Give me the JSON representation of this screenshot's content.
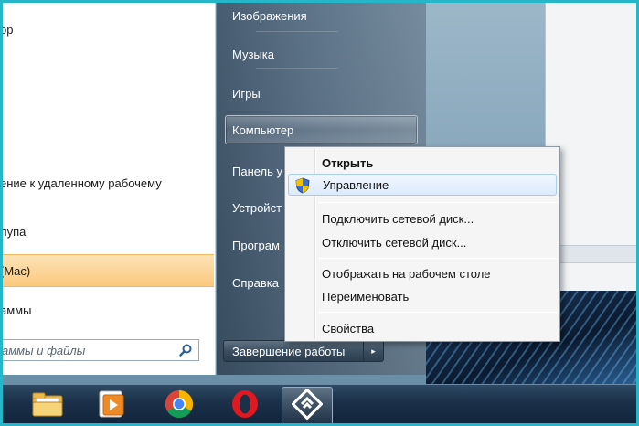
{
  "start_menu": {
    "left_items": [
      {
        "label": "ор"
      },
      {
        "label": "ение к удаленному рабочему"
      },
      {
        "label": "лупа"
      },
      {
        "label": "(Mac)"
      },
      {
        "label": "аммы"
      }
    ],
    "search": {
      "placeholder": "аммы и файлы",
      "icon": "search-icon"
    },
    "right_items": [
      {
        "label": "Изображения"
      },
      {
        "label": "Музыка"
      },
      {
        "label": "Игры"
      },
      {
        "label": "Компьютер"
      },
      {
        "label": "Панель у"
      },
      {
        "label": "Устройст"
      },
      {
        "label": "Програм"
      },
      {
        "label": "Справка"
      }
    ],
    "shutdown": {
      "label": "Завершение работы",
      "arrow": "▸"
    }
  },
  "context_menu": {
    "items": [
      {
        "label": "Открыть",
        "bold": true
      },
      {
        "label": "Управление",
        "icon": "uac-shield-icon",
        "hovered": true
      },
      {
        "label": "Подключить сетевой диск..."
      },
      {
        "label": "Отключить сетевой диск..."
      },
      {
        "label": "Отображать на рабочем столе"
      },
      {
        "label": "Переименовать"
      },
      {
        "label": "Свойства"
      }
    ]
  },
  "taskbar": {
    "buttons": [
      {
        "name": "file-explorer",
        "icon": "folder-icon"
      },
      {
        "name": "media-player",
        "icon": "media-player-icon"
      },
      {
        "name": "chrome",
        "icon": "chrome-icon"
      },
      {
        "name": "opera",
        "icon": "opera-icon"
      },
      {
        "name": "remote-desktop",
        "icon": "remote-desktop-icon",
        "active": true
      }
    ]
  },
  "colors": {
    "frame": "#25b7c9",
    "highlight": "#fbc97e",
    "context_hover": "#dcebfc"
  }
}
